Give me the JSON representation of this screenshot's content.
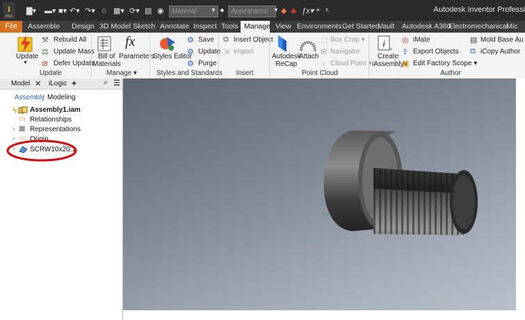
{
  "titlebar": {
    "app_title": "Autodesk Inventor Professi",
    "material_placeholder": "Material",
    "appearance_placeholder": "Appearance"
  },
  "tabs": [
    "File",
    "Assemble",
    "Design",
    "3D Model",
    "Sketch",
    "Annotate",
    "Inspect",
    "Tools",
    "Manage",
    "View",
    "Environments",
    "Get Started",
    "Vault",
    "Autodesk A360",
    "Electromechanical",
    "Mic"
  ],
  "active_tab": "Manage",
  "ribbon": {
    "update": {
      "label": "Update",
      "rebuild_all": "Rebuild All",
      "update_mass": "Update Mass",
      "defer_update": "Defer Update",
      "group": "Update"
    },
    "manage": {
      "bill_line1": "Bill of",
      "bill_line2": "Materials",
      "parameters": "Parameters",
      "group": "Manage"
    },
    "styles": {
      "styles_editor": "Styles Editor",
      "save": "Save",
      "update": "Update",
      "purge": "Purge",
      "group": "Styles and Standards"
    },
    "insert": {
      "insert_object": "Insert Object",
      "import": "Import",
      "group": "Insert"
    },
    "pointcloud": {
      "recap_line1": "Autodesk",
      "recap_line2": "ReCap",
      "attach": "Attach",
      "box_crop": "Box Crop",
      "navigator": "Navigator",
      "cloud_point": "Cloud Point",
      "group": "Point Cloud"
    },
    "author": {
      "create_line1": "Create",
      "create_line2": "iAssembly",
      "imate": "iMate",
      "export_objects": "Export Objects",
      "edit_factory_scope": "Edit Factory Scope",
      "mold_base": "Mold Base Au",
      "icopy_author": "iCopy Author",
      "group": "Author"
    }
  },
  "browser": {
    "tab_model": "Model",
    "tab_ilogic": "iLogic",
    "add_tab": "+",
    "subtab_assembly": "Assembly",
    "subtab_modeling": "Modeling",
    "nodes": {
      "root": "Assembly1.iam",
      "relationships": "Relationships",
      "representations": "Representations",
      "origin": "Origin",
      "screw": "SCRW10x20:1"
    }
  },
  "colors": {
    "accent": "#d6711e",
    "highlight_circle": "#e00000",
    "link_blue": "#1f6fc0"
  }
}
